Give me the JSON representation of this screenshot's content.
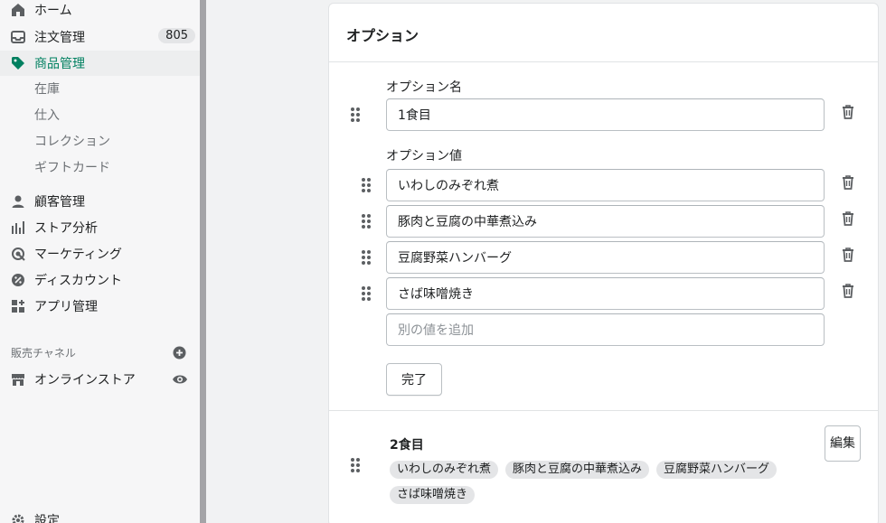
{
  "sidebar": {
    "items": [
      {
        "label": "ホーム",
        "icon": "home-icon"
      },
      {
        "label": "注文管理",
        "icon": "inbox-icon",
        "badge": "805"
      },
      {
        "label": "商品管理",
        "icon": "tag-icon",
        "active": true
      },
      {
        "label": "顧客管理",
        "icon": "person-icon"
      },
      {
        "label": "ストア分析",
        "icon": "analytics-icon"
      },
      {
        "label": "マーケティング",
        "icon": "marketing-icon"
      },
      {
        "label": "ディスカウント",
        "icon": "discount-icon"
      },
      {
        "label": "アプリ管理",
        "icon": "apps-icon"
      }
    ],
    "sub_items": [
      "在庫",
      "仕入",
      "コレクション",
      "ギフトカード"
    ],
    "channels_title": "販売チャネル",
    "channel_store": "オンラインストア",
    "settings": "設定",
    "accent_color": "#008060"
  },
  "card": {
    "title": "オプション",
    "option_name_label": "オプション名",
    "option_name_value": "1食目",
    "option_values_label": "オプション値",
    "option_values": [
      "いわしのみぞれ煮",
      "豚肉と豆腐の中華煮込み",
      "豆腐野菜ハンバーグ",
      "さば味噌焼き"
    ],
    "add_value_placeholder": "別の値を追加",
    "done_label": "完了",
    "group2": {
      "title": "2食目",
      "edit_label": "編集",
      "tags": [
        "いわしのみぞれ煮",
        "豚肉と豆腐の中華煮込み",
        "豆腐野菜ハンバーグ",
        "さば味噌焼き"
      ]
    }
  }
}
